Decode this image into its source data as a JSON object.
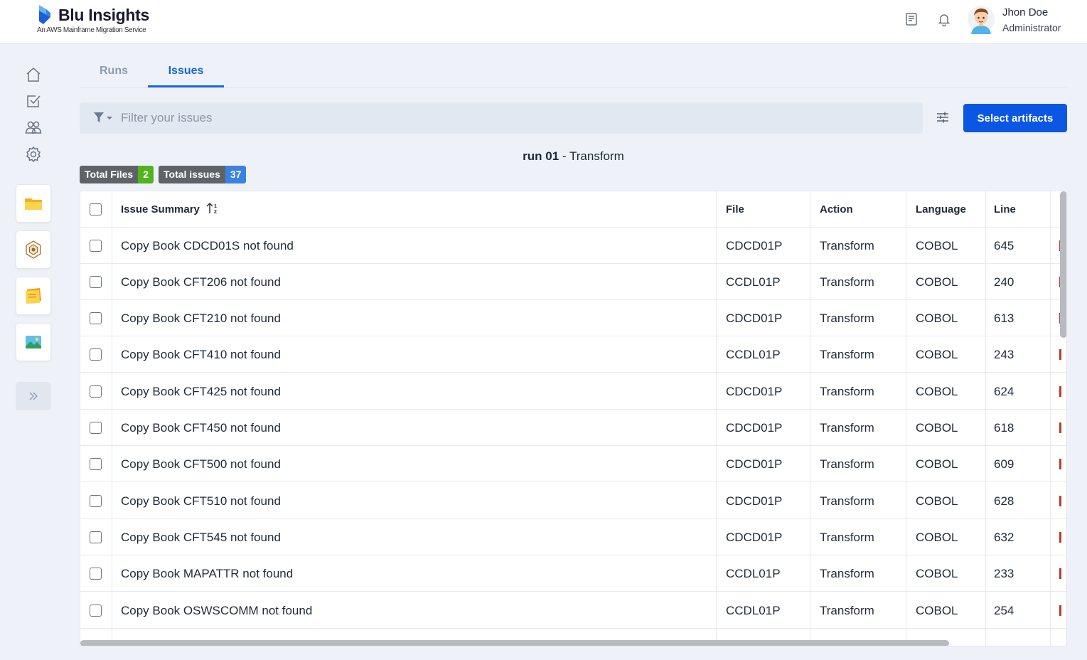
{
  "header": {
    "app_title": "Blu Insights",
    "app_subtitle": "An AWS Mainframe Migration Service",
    "user_name": "Jhon Doe",
    "user_role": "Administrator",
    "icons": [
      "docs-icon",
      "bell-icon",
      "avatar"
    ]
  },
  "sidebar": {
    "nav_icons": [
      "home-icon",
      "tasks-icon",
      "users-icon",
      "settings-icon"
    ],
    "app_icons": [
      "folder-app-icon",
      "codebase-app-icon",
      "notes-app-icon",
      "image-app-icon"
    ],
    "expand_icon": "double-chevron-right-icon"
  },
  "tabs": [
    {
      "label": "Runs",
      "active": false
    },
    {
      "label": "Issues",
      "active": true
    }
  ],
  "filter": {
    "placeholder": "Filter your issues"
  },
  "toolbar": {
    "select_artifacts_label": "Select artifacts"
  },
  "run": {
    "name": "run 01",
    "separator": " - ",
    "type": "Transform"
  },
  "badges": {
    "total_files_label": "Total Files",
    "total_files_count": "2",
    "total_issues_label": "Total issues",
    "total_issues_count": "37"
  },
  "colors": {
    "primary": "#0b57e3",
    "tab_active": "#1466d9",
    "files_badge": "#52b31d",
    "issues_badge": "#3b82e0"
  },
  "table": {
    "columns": [
      "Issue Summary",
      "File",
      "Action",
      "Language",
      "Line"
    ],
    "rows": [
      {
        "summary": "Copy Book CDCD01S not found",
        "file": "CDCD01P",
        "action": "Transform",
        "language": "COBOL",
        "line": "645"
      },
      {
        "summary": "Copy Book CFT206 not found",
        "file": "CCDL01P",
        "action": "Transform",
        "language": "COBOL",
        "line": "240"
      },
      {
        "summary": "Copy Book CFT210 not found",
        "file": "CDCD01P",
        "action": "Transform",
        "language": "COBOL",
        "line": "613"
      },
      {
        "summary": "Copy Book CFT410 not found",
        "file": "CCDL01P",
        "action": "Transform",
        "language": "COBOL",
        "line": "243"
      },
      {
        "summary": "Copy Book CFT425 not found",
        "file": "CDCD01P",
        "action": "Transform",
        "language": "COBOL",
        "line": "624"
      },
      {
        "summary": "Copy Book CFT450 not found",
        "file": "CDCD01P",
        "action": "Transform",
        "language": "COBOL",
        "line": "618"
      },
      {
        "summary": "Copy Book CFT500 not found",
        "file": "CDCD01P",
        "action": "Transform",
        "language": "COBOL",
        "line": "609"
      },
      {
        "summary": "Copy Book CFT510 not found",
        "file": "CDCD01P",
        "action": "Transform",
        "language": "COBOL",
        "line": "628"
      },
      {
        "summary": "Copy Book CFT545 not found",
        "file": "CDCD01P",
        "action": "Transform",
        "language": "COBOL",
        "line": "632"
      },
      {
        "summary": "Copy Book MAPATTR not found",
        "file": "CCDL01P",
        "action": "Transform",
        "language": "COBOL",
        "line": "233"
      },
      {
        "summary": "Copy Book OSWSCOMM not found",
        "file": "CCDL01P",
        "action": "Transform",
        "language": "COBOL",
        "line": "254"
      }
    ]
  }
}
